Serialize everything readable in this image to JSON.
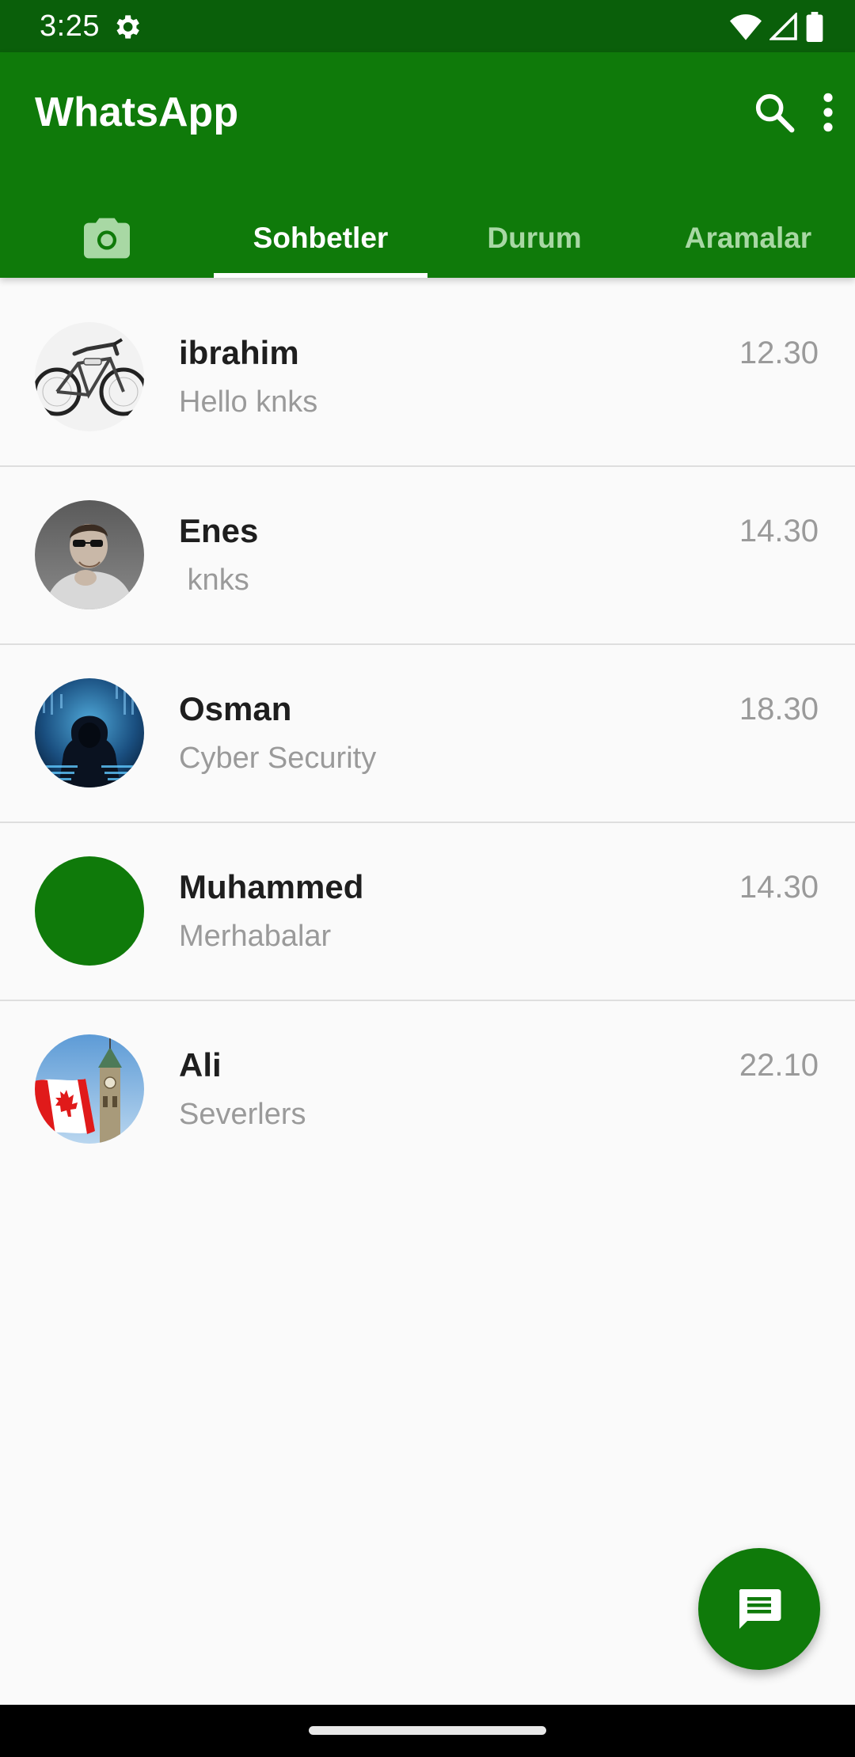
{
  "status_bar": {
    "time": "3:25",
    "icons": [
      "gear-icon",
      "wifi-icon",
      "signal-icon",
      "battery-icon"
    ]
  },
  "app_bar": {
    "title": "WhatsApp",
    "actions": [
      "search-icon",
      "more-vert-icon"
    ],
    "color": "#0f7a0a"
  },
  "tabs": [
    {
      "icon": "camera-icon",
      "label": ""
    },
    {
      "label": "Sohbetler",
      "active": true
    },
    {
      "label": "Durum"
    },
    {
      "label": "Aramalar"
    }
  ],
  "chats": [
    {
      "name": "ibrahim",
      "message": "Hello knks",
      "time": "12.30",
      "avatar": "bicycle-photo"
    },
    {
      "name": "Enes",
      "message": " knks",
      "time": "14.30",
      "avatar": "person-photo"
    },
    {
      "name": "Osman",
      "message": "Cyber Security",
      "time": "18.30",
      "avatar": "hacker-photo"
    },
    {
      "name": "Muhammed",
      "message": "Merhabalar",
      "time": "14.30",
      "avatar": "green-circle"
    },
    {
      "name": "Ali",
      "message": "Severlers",
      "time": "22.10",
      "avatar": "canada-flag-photo"
    }
  ],
  "fab": {
    "icon": "message-icon",
    "color": "#0f7a0a"
  }
}
